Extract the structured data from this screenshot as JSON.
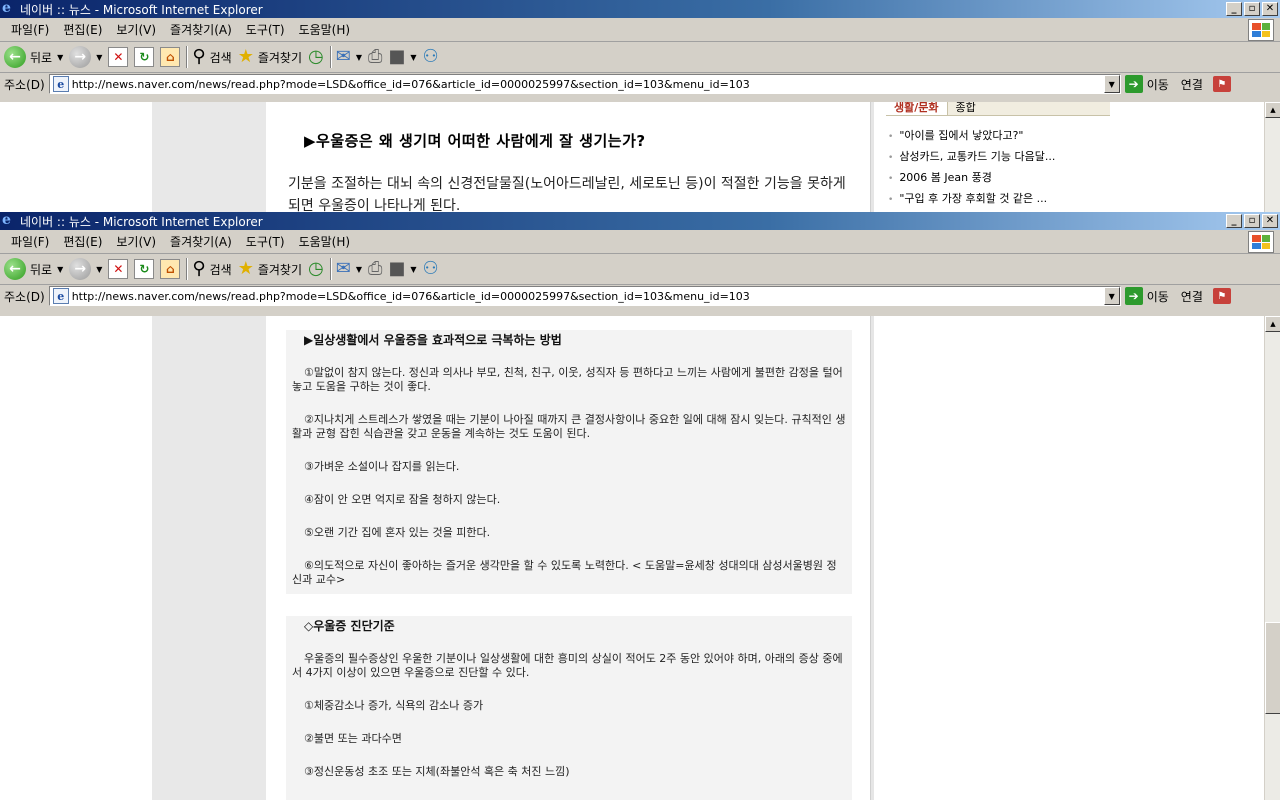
{
  "window": {
    "title": "네이버 :: 뉴스 - Microsoft Internet Explorer",
    "controls": {
      "minimize": "_",
      "maximize": "▫",
      "close": "✕"
    },
    "menus": [
      "파일(F)",
      "편집(E)",
      "보기(V)",
      "즐겨찾기(A)",
      "도구(T)",
      "도움말(H)"
    ],
    "toolbar": {
      "back": "뒤로",
      "search": "검색",
      "favorites": "즐겨찾기"
    },
    "address": {
      "label": "주소(D)",
      "url": "http://news.naver.com/news/read.php?mode=LSD&office_id=076&article_id=0000025997&section_id=103&menu_id=103",
      "go": "이동",
      "links": "연결"
    }
  },
  "article_top": {
    "heading": "▶우울증은 왜 생기며 어떠한 사람에게 잘 생기는가?",
    "para": "기분을 조절하는 대뇌 속의 신경전달물질(노어아드레날린, 세로토닌 등)이 적절한 기능을 못하게 되면 우울증이 나타나게 된다."
  },
  "sidebar": {
    "tabs": [
      "생활/문화",
      "종합"
    ],
    "news": [
      "\"아이를 집에서 낳았다고?\"",
      "삼성카드, 교통카드 기능 다음달...",
      "2006 봄 Jean 풍경",
      "\"구입 후 가장 후회할 것 같은 ..."
    ]
  },
  "article": {
    "box1": {
      "title": "▶일상생활에서 우울증을 효과적으로 극복하는 방법",
      "items": [
        "①말없이 참지 않는다. 정신과 의사나 부모, 친척, 친구, 이웃, 성직자 등 편하다고 느끼는 사람에게 불편한 감정을 털어놓고 도움을 구하는 것이 좋다.",
        "②지나치게 스트레스가 쌓였을 때는 기분이 나아질 때까지 큰 결정사항이나 중요한 일에 대해 잠시 잊는다. 규칙적인 생활과 균형 잡힌 식습관을 갖고 운동을 계속하는 것도 도움이 된다.",
        "③가벼운 소설이나 잡지를 읽는다.",
        "④잠이 안 오면 억지로 잠을 청하지 않는다.",
        "⑤오랜 기간 집에 혼자 있는 것을 피한다.",
        "⑥의도적으로 자신이 좋아하는 즐거운 생각만을 할 수 있도록 노력한다. < 도움말=윤세창 성대의대 삼성서울병원 정신과 교수>"
      ]
    },
    "box2": {
      "title": "◇우울증 진단기준",
      "intro": "우울증의 필수증상인 우울한 기분이나 일상생활에 대한 흥미의 상실이 적어도 2주 동안 있어야 하며, 아래의 증상 중에서 4가지 이상이 있으면 우울증으로 진단할 수 있다.",
      "items": [
        "①체중감소나 증가, 식욕의 감소나 증가",
        "②불면 또는 과다수면",
        "③정신운동성 초조 또는 지체(좌불안석 혹은 축 처진 느낌)"
      ]
    }
  }
}
